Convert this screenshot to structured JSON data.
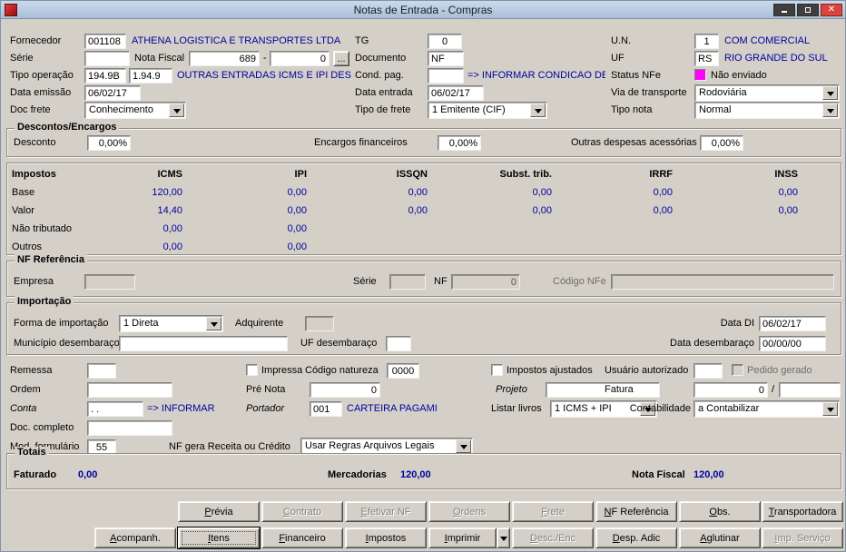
{
  "window": {
    "title": "Notas de Entrada - Compras"
  },
  "fields": {
    "fornecedor": {
      "label": "Fornecedor",
      "code": "001108",
      "name": "ATHENA LOGISTICA E TRANSPORTES LTDA"
    },
    "tg": {
      "label": "TG",
      "value": "0"
    },
    "un": {
      "label": "U.N.",
      "code": "1",
      "name": "COM COMERCIAL"
    },
    "serie": {
      "label": "Série",
      "value": ""
    },
    "nota_fiscal": {
      "label": "Nota Fiscal",
      "numero": "689",
      "separator": "-",
      "subnumero": "0",
      "browse": "..."
    },
    "documento": {
      "label": "Documento",
      "value": "NF"
    },
    "uf": {
      "label": "UF",
      "code": "RS",
      "name": "RIO GRANDE DO SUL"
    },
    "tipo_operacao": {
      "label": "Tipo operação",
      "code": "194.9B",
      "cfop": "1.94.9",
      "descricao": "OUTRAS ENTRADAS ICMS E IPI DEST"
    },
    "cond_pag": {
      "label": "Cond. pag.",
      "value": "",
      "hint": "=> INFORMAR CONDICAO DE PA"
    },
    "status_nfe": {
      "label": "Status NFe",
      "value": "Não enviado",
      "color": "#ff00ff"
    },
    "data_emissao": {
      "label": "Data emissão",
      "value": "06/02/17"
    },
    "data_entrada": {
      "label": "Data entrada",
      "value": "06/02/17"
    },
    "via_transporte": {
      "label": "Via de transporte",
      "value": "Rodoviária"
    },
    "doc_frete": {
      "label": "Doc frete",
      "value": "Conhecimento"
    },
    "tipo_frete": {
      "label": "Tipo de frete",
      "value": "1 Emitente (CIF)"
    },
    "tipo_nota": {
      "label": "Tipo nota",
      "value": "Normal"
    }
  },
  "descontos_encargos": {
    "title": "Descontos/Encargos",
    "desconto": {
      "label": "Desconto",
      "value": "0,00%"
    },
    "encargos": {
      "label": "Encargos financeiros",
      "value": "0,00%"
    },
    "outras_despesas": {
      "label": "Outras despesas acessórias",
      "value": "0,00%"
    }
  },
  "impostos": {
    "row_header": "Impostos",
    "columns": [
      "ICMS",
      "IPI",
      "ISSQN",
      "Subst. trib.",
      "IRRF",
      "INSS"
    ],
    "rows": [
      {
        "label": "Base",
        "values": [
          "120,00",
          "0,00",
          "0,00",
          "0,00",
          "0,00",
          "0,00"
        ]
      },
      {
        "label": "Valor",
        "values": [
          "14,40",
          "0,00",
          "0,00",
          "0,00",
          "0,00",
          "0,00"
        ]
      },
      {
        "label": "Não tributado",
        "values": [
          "0,00",
          "0,00",
          "",
          "",
          "",
          ""
        ]
      },
      {
        "label": "Outros",
        "values": [
          "0,00",
          "0,00",
          "",
          "",
          "",
          ""
        ]
      }
    ]
  },
  "nf_referencia": {
    "title": "NF Referência",
    "empresa": {
      "label": "Empresa",
      "value": ""
    },
    "serie": {
      "label": "Série",
      "value": ""
    },
    "nf": {
      "label": "NF",
      "value": "0"
    },
    "codigo_nfe": {
      "label": "Código NFe",
      "value": ""
    }
  },
  "importacao": {
    "title": "Importação",
    "forma": {
      "label": "Forma de importação",
      "value": "1 Direta"
    },
    "adquirente": {
      "label": "Adquirente",
      "value": ""
    },
    "data_di": {
      "label": "Data DI",
      "value": "06/02/17"
    },
    "municipio_desembaraco": {
      "label": "Município desembaraço",
      "value": ""
    },
    "uf_desembaraco": {
      "label": "UF desembaraço",
      "value": ""
    },
    "data_desembaraco": {
      "label": "Data desembaraço",
      "value": "00/00/00"
    }
  },
  "campos": {
    "remessa": {
      "label": "Remessa",
      "value": ""
    },
    "impressa": {
      "label": "Impressa",
      "checked": false
    },
    "codigo_natureza": {
      "label": "Código natureza",
      "value": "0000"
    },
    "impostos_ajustados": {
      "label": "Impostos ajustados",
      "checked": false
    },
    "usuario_autorizado": {
      "label": "Usuário autorizado",
      "value": ""
    },
    "pedido_gerado": {
      "label": "Pedido gerado",
      "checked": false
    },
    "ordem": {
      "label": "Ordem",
      "value": ""
    },
    "pre_nota": {
      "label": "Pré Nota",
      "value": "0"
    },
    "projeto": {
      "label": "Projeto",
      "value": ""
    },
    "fatura": {
      "label": "Fatura",
      "value": "0",
      "separator": "/",
      "parcela": ""
    },
    "conta": {
      "label": "Conta",
      "value": ". .",
      "hint": "=> INFORMAR"
    },
    "portador": {
      "label": "Portador",
      "value": "001",
      "hint": "CARTEIRA PAGAMI"
    },
    "listar_livros": {
      "label": "Listar livros",
      "value": "1 ICMS + IPI"
    },
    "contabilidade": {
      "label": "Contabilidade",
      "value": "a Contabilizar"
    },
    "doc_completo": {
      "label": "Doc. completo",
      "value": ""
    },
    "mod_formulario": {
      "label": "Mod. formulário",
      "value": "55"
    },
    "nf_gera": {
      "label": "NF gera Receita ou Crédito",
      "value": "Usar Regras Arquivos Legais"
    }
  },
  "totais": {
    "title": "Totais",
    "faturado": {
      "label": "Faturado",
      "value": "0,00"
    },
    "mercadorias": {
      "label": "Mercadorias",
      "value": "120,00"
    },
    "nota_fiscal": {
      "label": "Nota Fiscal",
      "value": "120,00"
    }
  },
  "botoes": {
    "row1": [
      {
        "label": "Prévia",
        "enabled": true
      },
      {
        "label": "Contrato",
        "enabled": false
      },
      {
        "label": "Efetivar NF",
        "enabled": false
      },
      {
        "label": "Ordens",
        "enabled": false
      },
      {
        "label": "Frete",
        "enabled": false
      },
      {
        "label": "NF Referência",
        "enabled": true
      },
      {
        "label": "Obs.",
        "enabled": true
      },
      {
        "label": "Transportadora",
        "enabled": true
      }
    ],
    "row2": [
      {
        "label": "Acompanh.",
        "enabled": true
      },
      {
        "label": "Itens",
        "enabled": true,
        "focused": true
      },
      {
        "label": "Financeiro",
        "enabled": true
      },
      {
        "label": "Impostos",
        "enabled": true
      },
      {
        "label": "Imprimir",
        "enabled": true,
        "has_dropdown": true
      },
      {
        "label": "Desc./Enc",
        "enabled": false
      },
      {
        "label": "Desp. Adic",
        "enabled": true
      },
      {
        "label": "Aglutinar",
        "enabled": true
      },
      {
        "label": "Imp. Serviço",
        "enabled": false
      }
    ]
  },
  "colors": {
    "background": "#d4d0c8",
    "accent_text": "#0000a0",
    "status_nfe": "#ff00ff",
    "titlebar": "#b9cde4"
  }
}
